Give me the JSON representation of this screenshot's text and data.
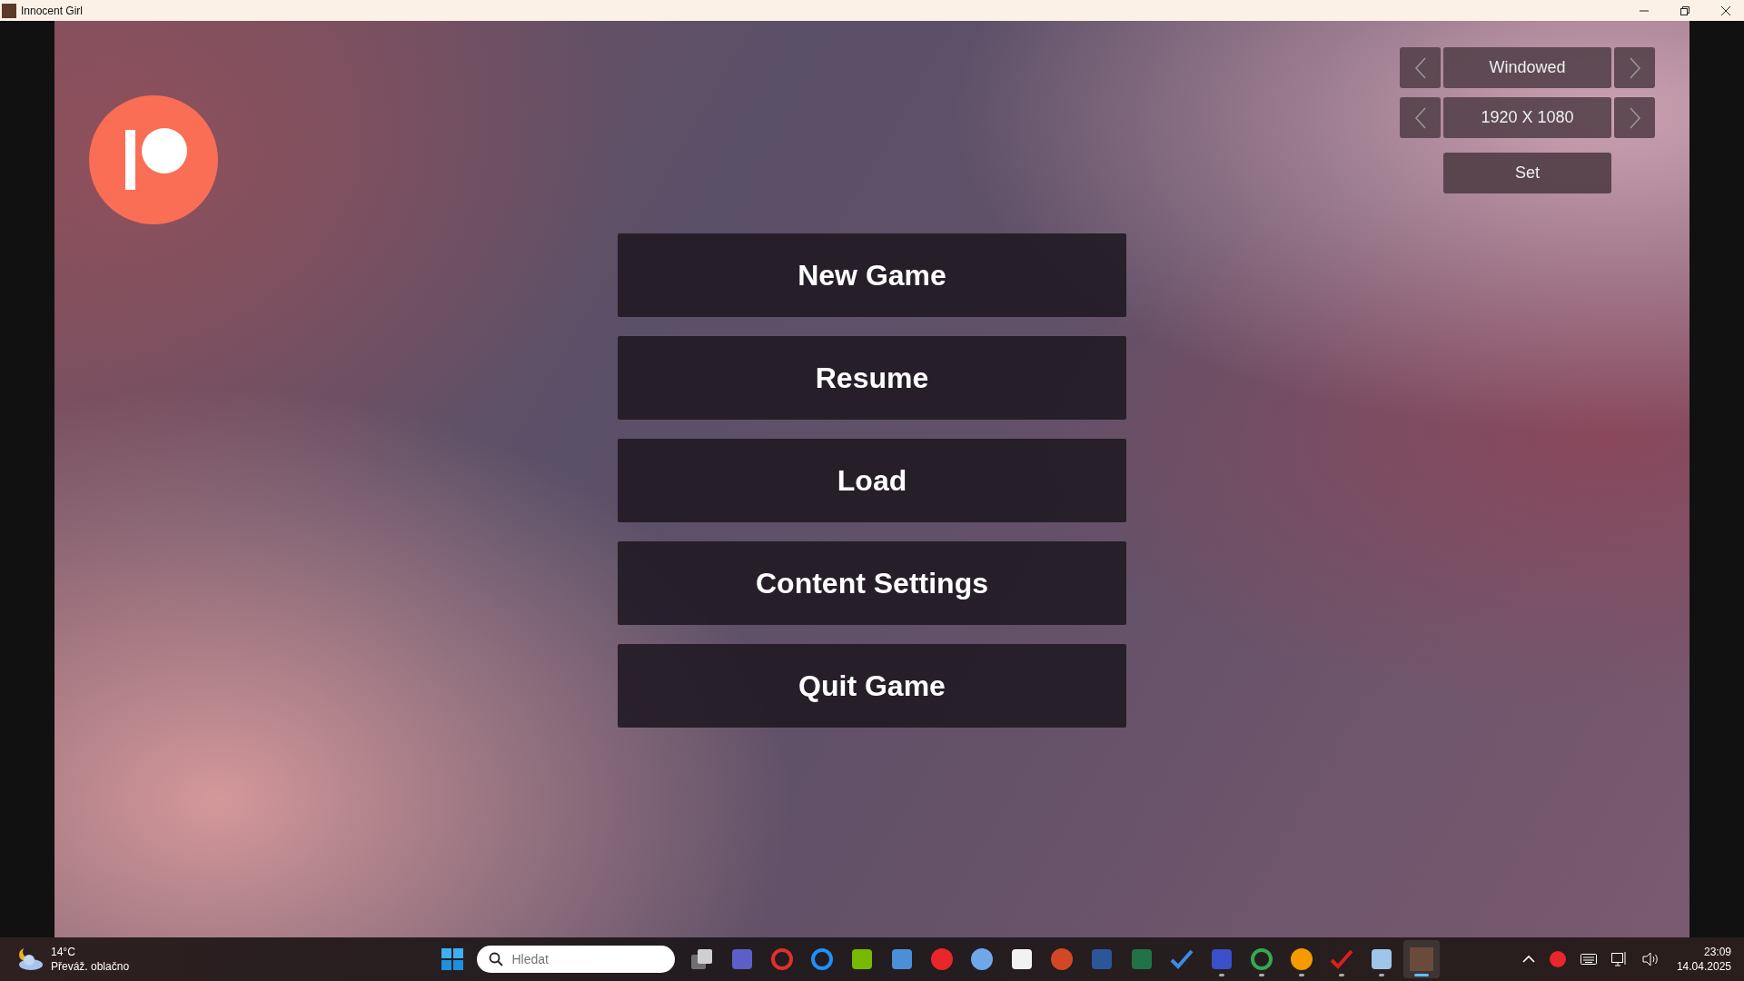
{
  "window": {
    "title": "Innocent Girl"
  },
  "menu": [
    {
      "label": "New Game"
    },
    {
      "label": "Resume"
    },
    {
      "label": "Load"
    },
    {
      "label": "Content Settings"
    },
    {
      "label": "Quit Game"
    }
  ],
  "display": {
    "mode": "Windowed",
    "resolution": "1920 X 1080",
    "set": "Set"
  },
  "taskbar": {
    "weather": {
      "temperature": "14°C",
      "condition": "Převáž. oblačno"
    },
    "search": {
      "placeholder": "Hledat"
    },
    "apps": [
      {
        "kind": "stack",
        "color": "#d0d0d0",
        "running": false,
        "selected": false
      },
      {
        "kind": "square",
        "color": "#5b5fc7",
        "running": false,
        "selected": false
      },
      {
        "kind": "ring",
        "color": "#e0302a",
        "running": false,
        "selected": false
      },
      {
        "kind": "ring",
        "color": "#1e90ff",
        "running": false,
        "selected": false
      },
      {
        "kind": "square",
        "color": "#76b900",
        "running": false,
        "selected": false
      },
      {
        "kind": "square",
        "color": "#4a8fd8",
        "running": false,
        "selected": false
      },
      {
        "kind": "circle",
        "color": "#e8262b",
        "running": false,
        "selected": false
      },
      {
        "kind": "circle",
        "color": "#6fa8e8",
        "running": false,
        "selected": false
      },
      {
        "kind": "square",
        "color": "#f2f2f2",
        "running": false,
        "selected": false
      },
      {
        "kind": "circle",
        "color": "#d24726",
        "running": false,
        "selected": false
      },
      {
        "kind": "square",
        "color": "#2b579a",
        "running": false,
        "selected": false
      },
      {
        "kind": "square",
        "color": "#217346",
        "running": false,
        "selected": false
      },
      {
        "kind": "check",
        "color": "#3c8be8",
        "running": false,
        "selected": false
      },
      {
        "kind": "square",
        "color": "#3a4fc8",
        "running": true,
        "selected": false
      },
      {
        "kind": "ring",
        "color": "#34a853",
        "running": true,
        "selected": false
      },
      {
        "kind": "circle",
        "color": "#f59b00",
        "running": true,
        "selected": false
      },
      {
        "kind": "check",
        "color": "#d82020",
        "running": true,
        "selected": false
      },
      {
        "kind": "square",
        "color": "#9fc6e8",
        "running": true,
        "selected": false
      },
      {
        "kind": "photo",
        "color": "#6a4a3a",
        "running": true,
        "selected": true
      }
    ],
    "clock": {
      "time": "23:09",
      "date": "14.04.2025"
    }
  }
}
